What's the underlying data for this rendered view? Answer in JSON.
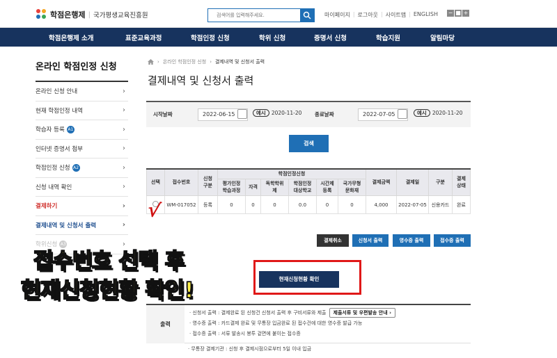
{
  "header": {
    "logo_name": "학점은행제",
    "logo_sub": "국가평생교육진흥원",
    "search_placeholder": "검색어를 입력해주세요.",
    "util_links": [
      "마이페이지",
      "로그아웃",
      "사이트맵",
      "ENGLISH"
    ],
    "font_size_controls": [
      "−",
      "■",
      "+"
    ]
  },
  "gnb": [
    "학점은행제 소개",
    "표준교육과정",
    "학점인정 신청",
    "학위 신청",
    "증명서 신청",
    "학습지원",
    "알림마당"
  ],
  "sidebar": {
    "title": "온라인 학점인정 신청",
    "items": [
      {
        "label": "온라인 신청 안내",
        "badge": ""
      },
      {
        "label": "현재 학점인정 내역",
        "badge": ""
      },
      {
        "label": "학습자 등록",
        "badge": "A1"
      },
      {
        "label": "인터넷 증명서 첨부",
        "badge": ""
      },
      {
        "label": "학점인정 신청",
        "badge": "A2"
      },
      {
        "label": "신청 내역 확인",
        "badge": ""
      },
      {
        "label": "결제하기",
        "badge": ""
      },
      {
        "label": "결제내역 및 신청서 출력",
        "badge": ""
      },
      {
        "label": "학위신청",
        "badge": "A3"
      }
    ]
  },
  "breadcrumb": [
    "온라인 학점인정 신청",
    "결제내역 및 신청서 출력"
  ],
  "page_title": "결제내역 및 신청서 출력",
  "filter": {
    "start_label": "시작날짜",
    "start_value": "2022-06-15",
    "start_example_tag": "예시",
    "start_example": "2020-11-20",
    "end_label": "종료날짜",
    "end_value": "2022-07-05",
    "end_example_tag": "예시",
    "end_example": "2020-11-20",
    "search_button": "검색"
  },
  "table": {
    "group_header": "학점인정신청",
    "headers": {
      "select": "선택",
      "receipt": "접수번호",
      "apply_type": "신청\n구분",
      "standard": "평가인정\n학습과정",
      "license": "자격",
      "self_degree": "독학학위\n제",
      "school": "학점인정\n대상학교",
      "parttime": "시간제\n등록",
      "heritage": "국가무형\n문화재",
      "amount": "결제금액",
      "pay_date": "결제일",
      "method": "구분",
      "status": "결제\n상태"
    },
    "row": {
      "receipt": "WM-017052",
      "apply_type": "등록",
      "standard": "0",
      "license": "0",
      "self_degree": "0",
      "school": "0.0",
      "parttime": "0",
      "heritage": "0",
      "amount": "4,000",
      "pay_date": "2022-07-05",
      "method": "신용카드",
      "status": "완료"
    }
  },
  "actions": [
    "결제취소",
    "신청서 출력",
    "영수증 출력",
    "접수증 출력"
  ],
  "overlay": {
    "line1": "접수번호 선택 후",
    "line2": "현재신청현황 확인!",
    "check": "√"
  },
  "status_button": "현재신청현황 확인",
  "info": {
    "label": "출력",
    "line1": "신청서 출력 : 결제완료 된 신청건 신청서 출력 후 구비서류와 제출",
    "line1_button": "제출서류 및 우편발송 안내",
    "line2": "영수증 출력 : 카드결제 완료 및 무통장 입금완료 된 접수건에 대한 영수증 발급 가능",
    "line3": "접수증 출력 : 서류 발송시 봉투 겉면에 붙이는 접수증",
    "line4": "무통장 결제기관 : 신청 후 결제시점으로부터 5일 이내 입금"
  },
  "colors": {
    "navy": "#17335e",
    "blue": "#1f6fb5",
    "red": "#d0312d",
    "overlay_yellow": "#fff04a"
  }
}
